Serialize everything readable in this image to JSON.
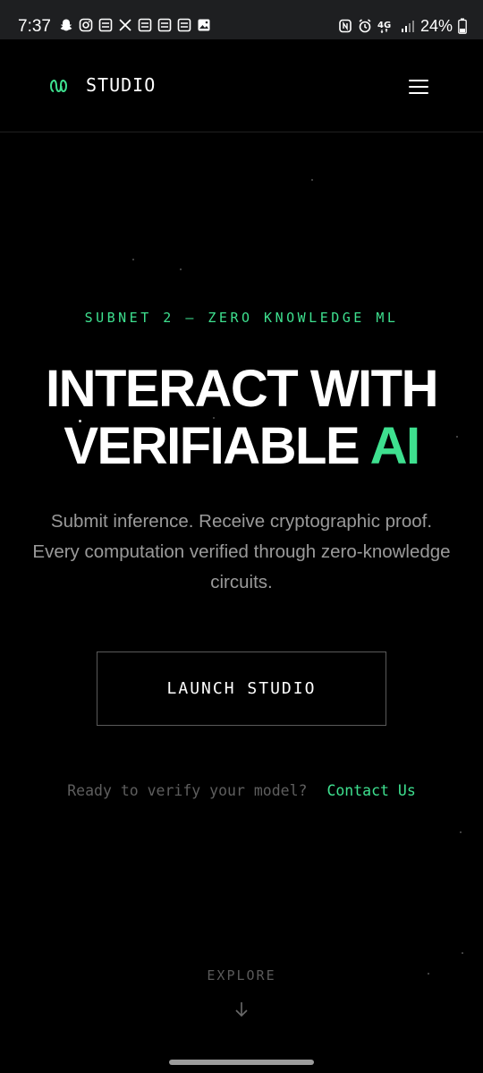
{
  "status_bar": {
    "time": "7:37",
    "battery": "24%",
    "left_icons": [
      "snapchat-icon",
      "instagram-icon",
      "app-icon",
      "x-icon",
      "app-icon",
      "app-icon",
      "app-icon",
      "gallery-icon"
    ],
    "right_icons": [
      "nfc-icon",
      "alarm-icon",
      "4g-icon",
      "signal-icon",
      "battery-icon"
    ]
  },
  "header": {
    "brand": "STUDIO",
    "logo_icon": "infinity-wave-logo",
    "menu_icon": "hamburger-menu-icon"
  },
  "hero": {
    "eyebrow": "SUBNET 2 — ZERO KNOWLEDGE ML",
    "headline_line1": "INTERACT WITH",
    "headline_line2_main": "VERIFIABLE",
    "headline_line2_accent": "AI",
    "subtext": "Submit inference. Receive cryptographic proof. Every computation verified through zero-knowledge circuits.",
    "launch_label": "LAUNCH STUDIO",
    "cta_text": "Ready to verify your model?",
    "cta_link": "Contact Us",
    "explore_label": "EXPLORE",
    "explore_icon": "arrow-down-icon"
  },
  "colors": {
    "accent": "#3ee08f",
    "background": "#000000",
    "muted_text": "#9a9a9a"
  }
}
